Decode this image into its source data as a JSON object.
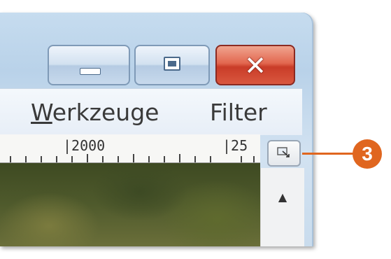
{
  "window": {
    "close_glyph": "✕"
  },
  "menu": {
    "items": [
      {
        "label": "Werkzeuge"
      },
      {
        "label": "Filter"
      }
    ]
  },
  "ruler": {
    "labels": [
      "|2000",
      "|25"
    ]
  },
  "navigator": {
    "icon": "navigator-icon"
  },
  "scrollbar": {
    "up_arrow": "▲"
  },
  "callout": {
    "number": "3",
    "color": "#e0661f"
  }
}
